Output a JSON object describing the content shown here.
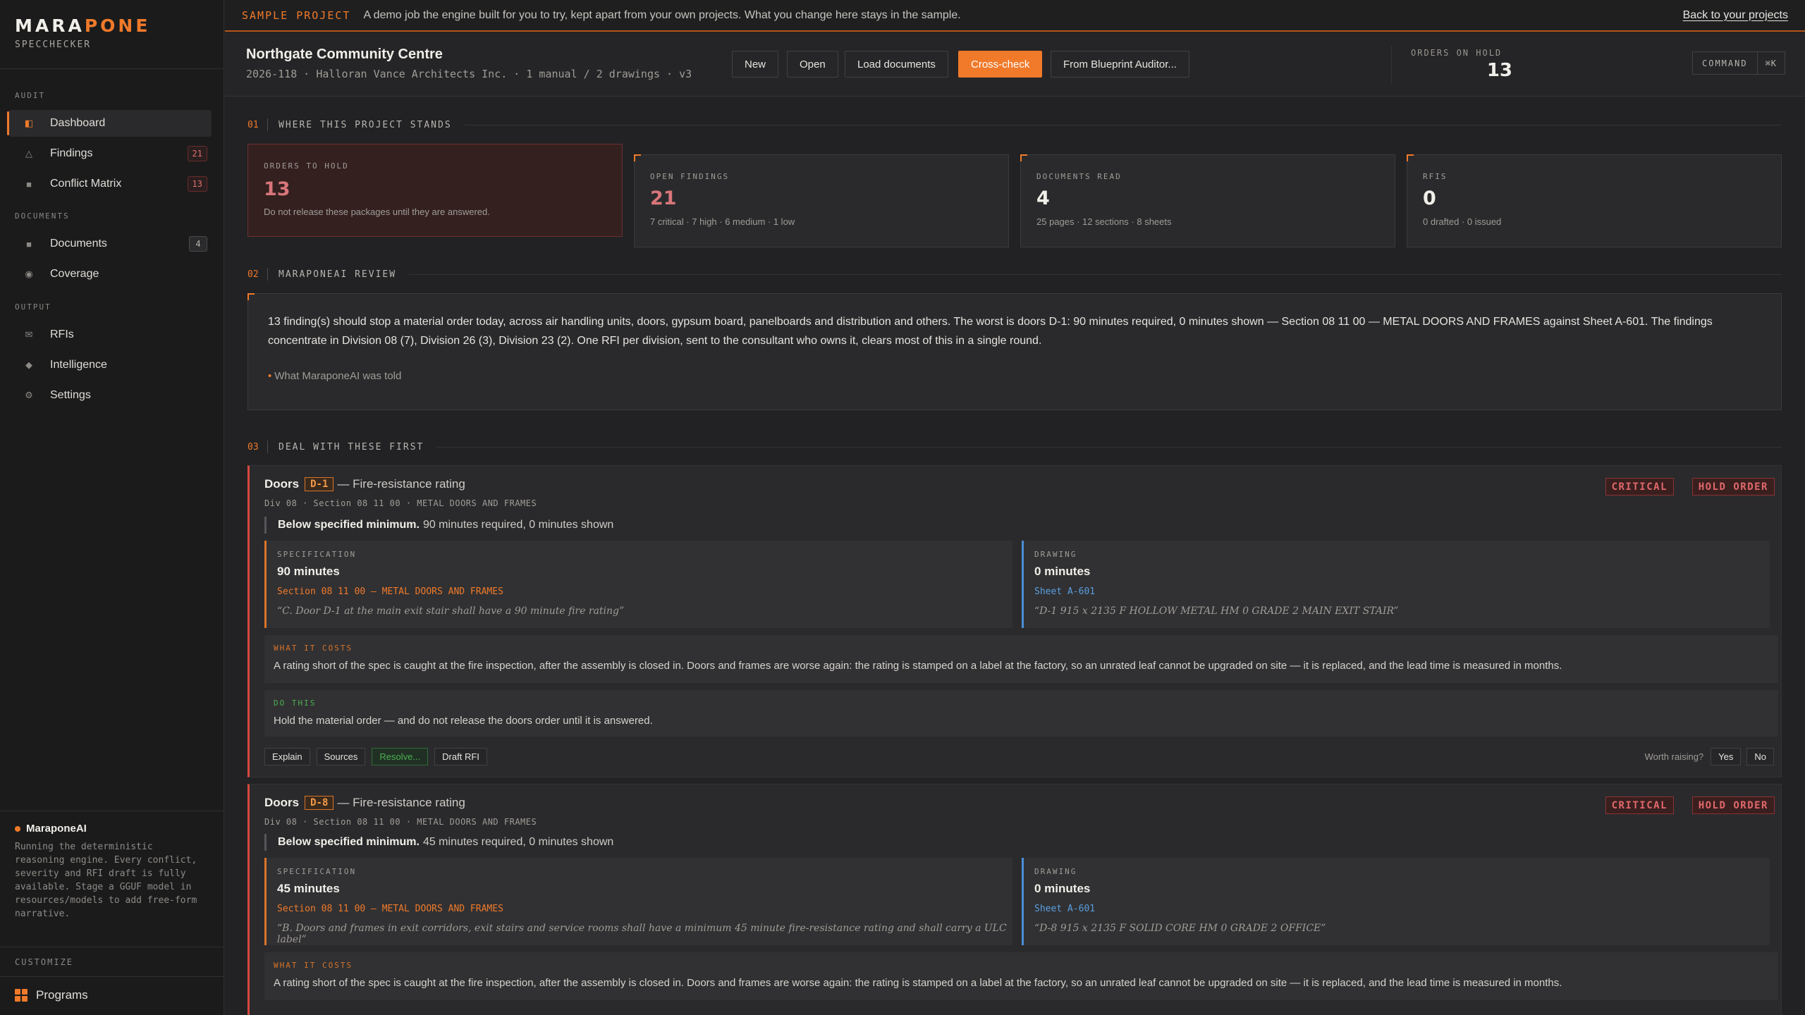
{
  "brand": {
    "name_a": "MARA",
    "name_b": "PONE",
    "subtitle": "SPECCHECKER"
  },
  "sidebar": {
    "sections": {
      "audit": "AUDIT",
      "documents": "DOCUMENTS",
      "output": "OUTPUT"
    },
    "items": [
      {
        "label": "Dashboard",
        "icon": "dashboard-icon",
        "active": true
      },
      {
        "label": "Findings",
        "icon": "warning-triangle-icon",
        "badge": "21"
      },
      {
        "label": "Conflict Matrix",
        "icon": "matrix-square-icon",
        "badge": "13"
      },
      {
        "label": "Documents",
        "icon": "document-square-icon",
        "badge": "4"
      },
      {
        "label": "Coverage",
        "icon": "coverage-circle-icon"
      },
      {
        "label": "RFIs",
        "icon": "mail-icon"
      },
      {
        "label": "Intelligence",
        "icon": "diamond-icon"
      },
      {
        "label": "Settings",
        "icon": "gear-icon"
      }
    ],
    "ai": {
      "title": "MaraponeAI",
      "text": "Running the deterministic reasoning engine. Every conflict, severity and RFI draft is fully available. Stage a GGUF model in resources/models to add free-form narrative."
    },
    "customize": "CUSTOMIZE",
    "programs": "Programs"
  },
  "banner": {
    "tag": "SAMPLE PROJECT",
    "text": "A demo job the engine built for you to try, kept apart from your own projects. What you change here stays in the sample.",
    "link": "Back to your projects"
  },
  "header": {
    "title": "Northgate Community Centre",
    "meta": "2026-118 · Halloran Vance Architects Inc. · 1 manual / 2 drawings · v3",
    "buttons": {
      "new": "New",
      "open": "Open",
      "load": "Load documents",
      "crosscheck": "Cross-check",
      "blueprint": "From Blueprint Auditor..."
    },
    "orders_label": "ORDERS ON HOLD",
    "orders_value": "13",
    "command": "COMMAND",
    "command_key": "⌘K"
  },
  "sections": {
    "s1": {
      "num": "01",
      "title": "WHERE THIS PROJECT STANDS"
    },
    "s2": {
      "num": "02",
      "title": "MARAPONEAI REVIEW"
    },
    "s3": {
      "num": "03",
      "title": "DEAL WITH THESE FIRST"
    }
  },
  "stats": [
    {
      "label": "ORDERS TO HOLD",
      "value": "13",
      "sub": "Do not release these packages until they are answered."
    },
    {
      "label": "OPEN FINDINGS",
      "value": "21",
      "sub": "7 critical · 7 high · 6 medium · 1 low"
    },
    {
      "label": "DOCUMENTS READ",
      "value": "4",
      "sub": "25 pages · 12 sections · 8 sheets"
    },
    {
      "label": "RFIS",
      "value": "0",
      "sub": "0 drafted · 0 issued"
    }
  ],
  "review": {
    "text": "13 finding(s) should stop a material order today, across air handling units, doors, gypsum board, panelboards and distribution and others. The worst is doors D-1: 90 minutes required, 0 minutes shown — Section 08 11 00 — METAL DOORS AND FRAMES against Sheet A-601. The findings concentrate in Division 08 (7), Division 26 (3), Division 23 (2). One RFI per division, sent to the consultant who owns it, clears most of this in a single round.",
    "told": "What MaraponeAI was told"
  },
  "findings": [
    {
      "category": "Doors",
      "tag": "D-1",
      "rest": "— Fire-resistance rating",
      "path": "Div 08 · Section 08 11 00 · METAL DOORS AND FRAMES",
      "severity": "CRITICAL",
      "hold": "HOLD ORDER",
      "summary_bold": "Below specified minimum.",
      "summary": "90 minutes required, 0 minutes shown",
      "spec_label": "SPECIFICATION",
      "spec_value": "90 minutes",
      "spec_ref": "Section 08 11 00 — METAL DOORS AND FRAMES",
      "spec_quote": "“C. Door D-1 at the main exit stair shall have a 90 minute fire rating”",
      "draw_label": "DRAWING",
      "draw_value": "0 minutes",
      "draw_ref": "Sheet A-601",
      "draw_quote": "“D-1 915 x 2135 F HOLLOW METAL HM 0 GRADE 2 MAIN EXIT STAIR”",
      "cost_label": "WHAT IT COSTS",
      "cost": "A rating short of the spec is caught at the fire inspection, after the assembly is closed in. Doors and frames are worse again: the rating is stamped on a label at the factory, so an unrated leaf cannot be upgraded on site — it is replaced, and the lead time is measured in months.",
      "do_label": "DO THIS",
      "do": "Hold the material order — and do not release the doors order until it is answered.",
      "actions": {
        "explain": "Explain",
        "sources": "Sources",
        "resolve": "Resolve...",
        "rfi": "Draft RFI"
      },
      "worth": "Worth raising?",
      "yes": "Yes",
      "no": "No"
    },
    {
      "category": "Doors",
      "tag": "D-8",
      "rest": "— Fire-resistance rating",
      "path": "Div 08 · Section 08 11 00 · METAL DOORS AND FRAMES",
      "severity": "CRITICAL",
      "hold": "HOLD ORDER",
      "summary_bold": "Below specified minimum.",
      "summary": "45 minutes required, 0 minutes shown",
      "spec_label": "SPECIFICATION",
      "spec_value": "45 minutes",
      "spec_ref": "Section 08 11 00 — METAL DOORS AND FRAMES",
      "spec_quote": "“B. Doors and frames in exit corridors, exit stairs and service rooms shall have a minimum 45 minute fire-resistance rating and shall carry a ULC label”",
      "draw_label": "DRAWING",
      "draw_value": "0 minutes",
      "draw_ref": "Sheet A-601",
      "draw_quote": "“D-8 915 x 2135 F SOLID CORE HM 0 GRADE 2 OFFICE”",
      "cost_label": "WHAT IT COSTS",
      "cost": "A rating short of the spec is caught at the fire inspection, after the assembly is closed in. Doors and frames are worse again: the rating is stamped on a label at the factory, so an unrated leaf cannot be upgraded on site — it is replaced, and the lead time is measured in months."
    }
  ],
  "colors": {
    "accent": "#f07a2a",
    "critical": "#d8483e",
    "drawing": "#4a8ed6",
    "do": "#4caf50"
  }
}
